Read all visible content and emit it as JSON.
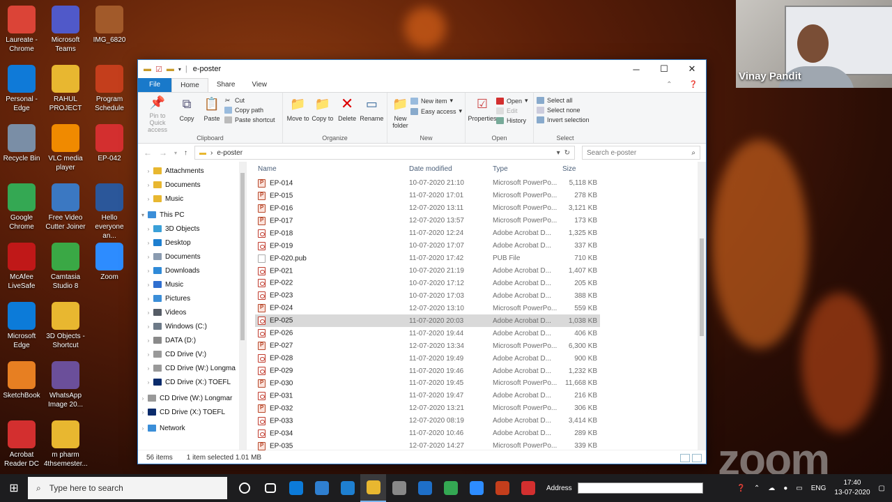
{
  "desktop_icons": [
    {
      "label": "Laureate - Chrome",
      "color": "#db4437"
    },
    {
      "label": "Microsoft Teams",
      "color": "#5059c9"
    },
    {
      "label": "IMG_6820",
      "color": "#a25a2a"
    },
    {
      "label": "Personal - Edge",
      "color": "#0f7ad8"
    },
    {
      "label": "RAHUL PROJECT",
      "color": "#e8b730"
    },
    {
      "label": "Program Schedule",
      "color": "#c43e1c"
    },
    {
      "label": "Recycle Bin",
      "color": "#7a8ea6"
    },
    {
      "label": "VLC media player",
      "color": "#f08a00"
    },
    {
      "label": "EP-042",
      "color": "#d32f2f"
    },
    {
      "label": "Google Chrome",
      "color": "#34a853"
    },
    {
      "label": "Free Video Cutter Joiner",
      "color": "#3b78c2"
    },
    {
      "label": "Hello everyone an...",
      "color": "#2b579a"
    },
    {
      "label": "McAfee LiveSafe",
      "color": "#c01818"
    },
    {
      "label": "Camtasia Studio 8",
      "color": "#3aa845"
    },
    {
      "label": "Microsoft Edge",
      "color": "#0c7bd9"
    },
    {
      "label": "3D Objects - Shortcut",
      "color": "#e8b730"
    },
    {
      "label": "SketchBook",
      "color": "#e77f22"
    },
    {
      "label": "WhatsApp Image 20...",
      "color": "#6b4f9a"
    },
    {
      "label": "Zoom",
      "color": "#2d8cff"
    },
    {
      "label": "Acrobat Reader DC",
      "color": "#d32f2f"
    },
    {
      "label": "m pharm 4thsemester...",
      "color": "#e8b730"
    }
  ],
  "window": {
    "title": "e-poster",
    "controls": {
      "minimize": "─",
      "maximize": "☐",
      "close": "✕"
    }
  },
  "ribbon_tabs": [
    "File",
    "Home",
    "Share",
    "View"
  ],
  "ribbon": {
    "clipboard": {
      "pin": "Pin to Quick access",
      "copy": "Copy",
      "paste": "Paste",
      "cut": "Cut",
      "copy_path": "Copy path",
      "paste_shortcut": "Paste shortcut",
      "group": "Clipboard"
    },
    "organize": {
      "move": "Move to",
      "copy": "Copy to",
      "delete": "Delete",
      "rename": "Rename",
      "group": "Organize"
    },
    "new": {
      "new_folder": "New folder",
      "new_item": "New item",
      "easy_access": "Easy access",
      "group": "New"
    },
    "open": {
      "properties": "Properties",
      "open": "Open",
      "edit": "Edit",
      "history": "History",
      "group": "Open"
    },
    "select": {
      "all": "Select all",
      "none": "Select none",
      "invert": "Invert selection",
      "group": "Select"
    }
  },
  "address": {
    "path": "e-poster",
    "search_placeholder": "Search e-poster"
  },
  "nav_items": [
    {
      "label": "Attachments",
      "color": "#e8b730",
      "indent": 1
    },
    {
      "label": "Documents",
      "color": "#e8b730",
      "indent": 1
    },
    {
      "label": "Music",
      "color": "#e8b730",
      "indent": 1
    },
    {
      "label": "This PC",
      "color": "#3b8ed8",
      "indent": 0
    },
    {
      "label": "3D Objects",
      "color": "#3aa0d8",
      "indent": 1
    },
    {
      "label": "Desktop",
      "color": "#1e7fd0",
      "indent": 1
    },
    {
      "label": "Documents",
      "color": "#8a9bb0",
      "indent": 1
    },
    {
      "label": "Downloads",
      "color": "#2f8ad8",
      "indent": 1
    },
    {
      "label": "Music",
      "color": "#2f6fd0",
      "indent": 1
    },
    {
      "label": "Pictures",
      "color": "#3b8ed8",
      "indent": 1
    },
    {
      "label": "Videos",
      "color": "#555c66",
      "indent": 1
    },
    {
      "label": "Windows (C:)",
      "color": "#6d7a88",
      "indent": 1
    },
    {
      "label": "DATA (D:)",
      "color": "#8a8a8a",
      "indent": 1
    },
    {
      "label": "CD Drive (V:)",
      "color": "#999999",
      "indent": 1
    },
    {
      "label": "CD Drive (W:) Longma",
      "color": "#999999",
      "indent": 1
    },
    {
      "label": "CD Drive (X:) TOEFL",
      "color": "#0a2b6b",
      "indent": 1
    },
    {
      "label": "CD Drive (W:) Longmar",
      "color": "#999999",
      "indent": 0
    },
    {
      "label": "CD Drive (X:) TOEFL",
      "color": "#0a2b6b",
      "indent": 0
    },
    {
      "label": "Network",
      "color": "#3b8ed8",
      "indent": 0
    }
  ],
  "columns": {
    "name": "Name",
    "date": "Date modified",
    "type": "Type",
    "size": "Size"
  },
  "files": [
    {
      "name": "EP-014",
      "date": "10-07-2020 21:10",
      "type": "Microsoft PowerPo...",
      "size": "5,118 KB",
      "kind": "ppt"
    },
    {
      "name": "EP-015",
      "date": "11-07-2020 17:01",
      "type": "Microsoft PowerPo...",
      "size": "278 KB",
      "kind": "ppt"
    },
    {
      "name": "EP-016",
      "date": "12-07-2020 13:11",
      "type": "Microsoft PowerPo...",
      "size": "3,121 KB",
      "kind": "ppt"
    },
    {
      "name": "EP-017",
      "date": "12-07-2020 13:57",
      "type": "Microsoft PowerPo...",
      "size": "173 KB",
      "kind": "ppt"
    },
    {
      "name": "EP-018",
      "date": "11-07-2020 12:24",
      "type": "Adobe Acrobat D...",
      "size": "1,325 KB",
      "kind": "pdf"
    },
    {
      "name": "EP-019",
      "date": "10-07-2020 17:07",
      "type": "Adobe Acrobat D...",
      "size": "337 KB",
      "kind": "pdf"
    },
    {
      "name": "EP-020.pub",
      "date": "11-07-2020 17:42",
      "type": "PUB File",
      "size": "710 KB",
      "kind": "pub"
    },
    {
      "name": "EP-021",
      "date": "10-07-2020 21:19",
      "type": "Adobe Acrobat D...",
      "size": "1,407 KB",
      "kind": "pdf"
    },
    {
      "name": "EP-022",
      "date": "10-07-2020 17:12",
      "type": "Adobe Acrobat D...",
      "size": "205 KB",
      "kind": "pdf"
    },
    {
      "name": "EP-023",
      "date": "10-07-2020 17:03",
      "type": "Adobe Acrobat D...",
      "size": "388 KB",
      "kind": "pdf"
    },
    {
      "name": "EP-024",
      "date": "12-07-2020 13:10",
      "type": "Microsoft PowerPo...",
      "size": "559 KB",
      "kind": "ppt"
    },
    {
      "name": "EP-025",
      "date": "11-07-2020 20:03",
      "type": "Adobe Acrobat D...",
      "size": "1,038 KB",
      "kind": "pdf",
      "selected": true
    },
    {
      "name": "EP-026",
      "date": "11-07-2020 19:44",
      "type": "Adobe Acrobat D...",
      "size": "406 KB",
      "kind": "pdf"
    },
    {
      "name": "EP-027",
      "date": "12-07-2020 13:34",
      "type": "Microsoft PowerPo...",
      "size": "6,300 KB",
      "kind": "ppt"
    },
    {
      "name": "EP-028",
      "date": "11-07-2020 19:49",
      "type": "Adobe Acrobat D...",
      "size": "900 KB",
      "kind": "pdf"
    },
    {
      "name": "EP-029",
      "date": "11-07-2020 19:46",
      "type": "Adobe Acrobat D...",
      "size": "1,232 KB",
      "kind": "pdf"
    },
    {
      "name": "EP-030",
      "date": "11-07-2020 19:45",
      "type": "Microsoft PowerPo...",
      "size": "11,668 KB",
      "kind": "ppt"
    },
    {
      "name": "EP-031",
      "date": "11-07-2020 19:47",
      "type": "Adobe Acrobat D...",
      "size": "216 KB",
      "kind": "pdf"
    },
    {
      "name": "EP-032",
      "date": "12-07-2020 13:21",
      "type": "Microsoft PowerPo...",
      "size": "306 KB",
      "kind": "ppt"
    },
    {
      "name": "EP-033",
      "date": "12-07-2020 08:19",
      "type": "Adobe Acrobat D...",
      "size": "3,414 KB",
      "kind": "pdf"
    },
    {
      "name": "EP-034",
      "date": "11-07-2020 10:46",
      "type": "Adobe Acrobat D...",
      "size": "289 KB",
      "kind": "pdf"
    },
    {
      "name": "EP-035",
      "date": "12-07-2020 14:27",
      "type": "Microsoft PowerPo...",
      "size": "339 KB",
      "kind": "ppt"
    }
  ],
  "status": {
    "count": "56 items",
    "selection": "1 item selected  1.01 MB"
  },
  "video": {
    "name": "Vinay Pandit"
  },
  "zoom_logo": "zoom",
  "taskbar": {
    "search_placeholder": "Type here to search",
    "address_label": "Address",
    "lang": "ENG",
    "time": "17:40",
    "date": "13-07-2020",
    "apps": [
      {
        "name": "cortana",
        "color": "#1d1d1f"
      },
      {
        "name": "task-view",
        "color": "#1d1d1f"
      },
      {
        "name": "edge",
        "color": "#0c7bd9"
      },
      {
        "name": "store",
        "color": "#2f7fd0"
      },
      {
        "name": "mail",
        "color": "#1e7fd0"
      },
      {
        "name": "file-explorer",
        "color": "#e8b730",
        "active": true
      },
      {
        "name": "winscp",
        "color": "#888888"
      },
      {
        "name": "photos",
        "color": "#1e6fc8"
      },
      {
        "name": "chrome",
        "color": "#34a853"
      },
      {
        "name": "zoom",
        "color": "#2d8cff"
      },
      {
        "name": "powerpoint",
        "color": "#c43e1c"
      },
      {
        "name": "acrobat",
        "color": "#d32f2f"
      }
    ]
  }
}
